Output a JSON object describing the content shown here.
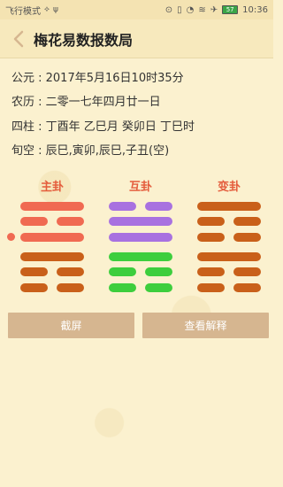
{
  "status": {
    "left": "飞行模式",
    "time": "10:36",
    "battery": "57"
  },
  "header": {
    "title": "梅花易数报数局"
  },
  "info": {
    "gongyuan": "公元 : 2017年5月16日10时35分",
    "nongli": "农历 : 二零一七年四月廿一日",
    "sizhu": "四柱 : 丁酉年 乙巳月 癸卯日 丁巳时",
    "xunkong": "旬空 : 辰巳,寅卯,辰巳,子丑(空)"
  },
  "hexagrams": {
    "main": {
      "title": "主卦",
      "color_top": "#f06a52",
      "color_bottom": "#c9601a"
    },
    "mutual": {
      "title": "互卦",
      "color_top": "#a871e0",
      "color_bottom": "#3dce3d"
    },
    "changed": {
      "title": "变卦",
      "color_top": "#c9601a",
      "color_bottom": "#c9601a"
    }
  },
  "buttons": {
    "screenshot": "截屏",
    "explain": "查看解释"
  }
}
